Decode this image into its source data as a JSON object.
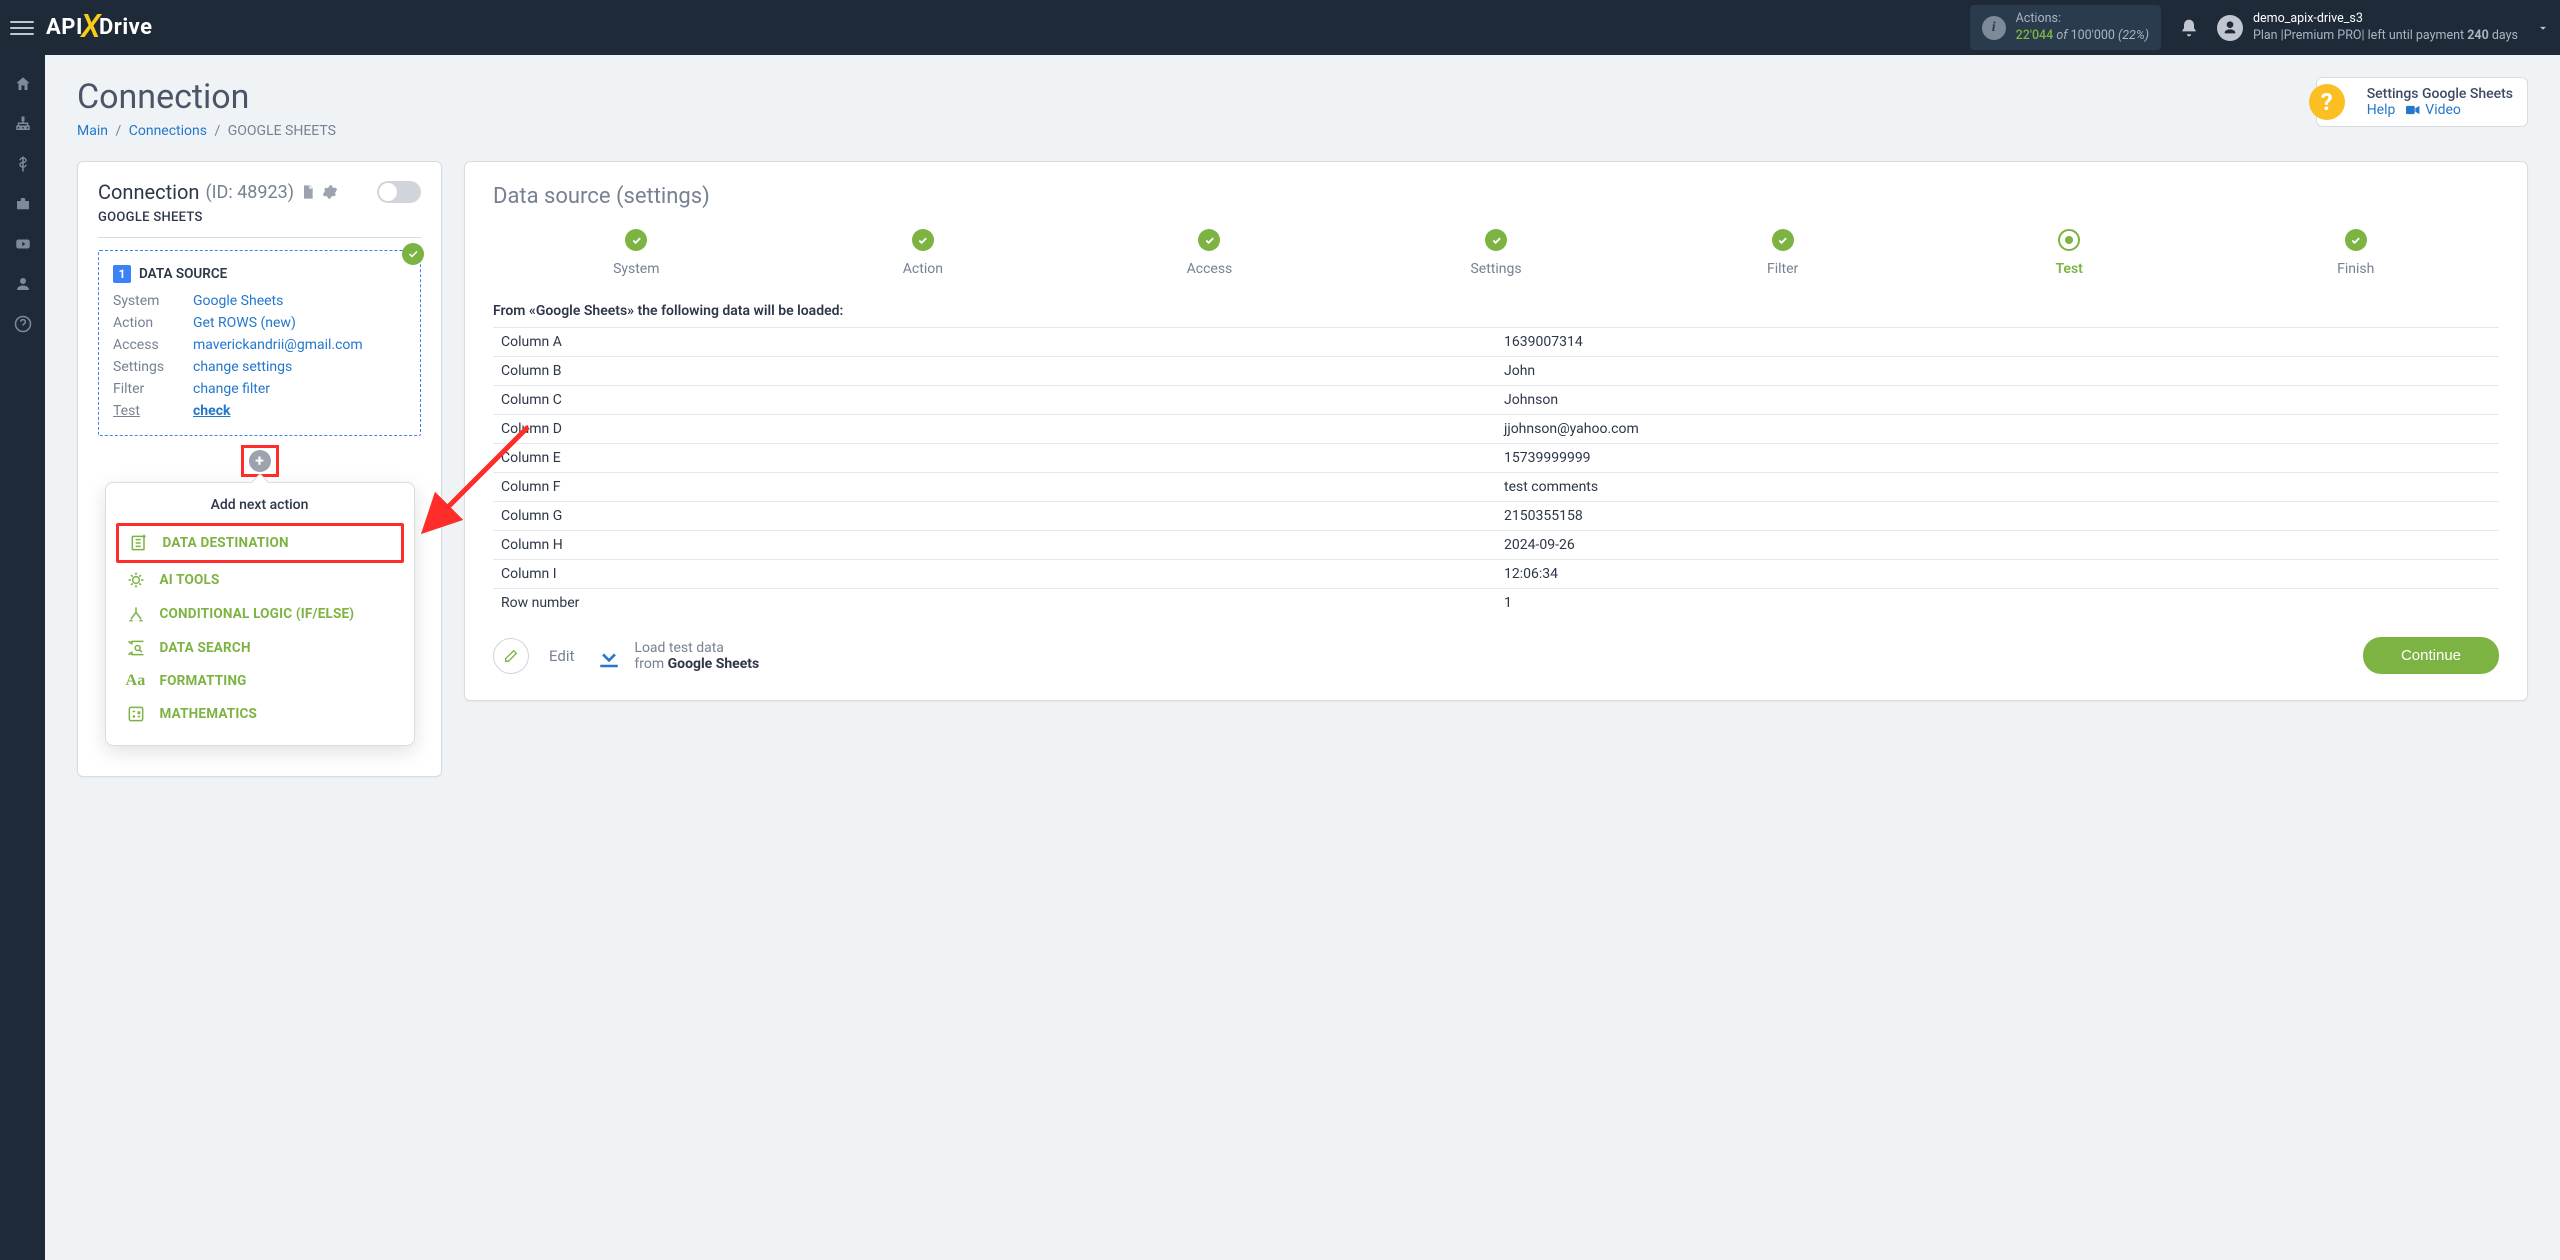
{
  "header": {
    "logo_prefix": "API",
    "logo_suffix": "Drive",
    "actions_label": "Actions:",
    "actions_count": "22'044",
    "actions_of": "of",
    "actions_total": "100'000",
    "actions_pct": "(22%)",
    "user_name": "demo_apix-drive_s3",
    "plan_prefix": "Plan |Premium PRO| left until payment ",
    "plan_days": "240",
    "plan_suffix": " days"
  },
  "page": {
    "title": "Connection",
    "breadcrumb_main": "Main",
    "breadcrumb_conn": "Connections",
    "breadcrumb_current": "GOOGLE SHEETS"
  },
  "help": {
    "title": "Settings Google Sheets",
    "help_link": "Help",
    "video_link": "Video"
  },
  "left": {
    "card_title": "Connection",
    "card_id": "(ID: 48923)",
    "conn_type": "GOOGLE SHEETS",
    "source_header": "DATA SOURCE",
    "rows": [
      {
        "label": "System",
        "value": "Google Sheets"
      },
      {
        "label": "Action",
        "value": "Get ROWS (new)"
      },
      {
        "label": "Access",
        "value": "maverickandrii@gmail.com"
      },
      {
        "label": "Settings",
        "value": "change settings"
      },
      {
        "label": "Filter",
        "value": "change filter"
      },
      {
        "label": "Test",
        "value": "check"
      }
    ]
  },
  "popover": {
    "title": "Add next action",
    "items": [
      "DATA DESTINATION",
      "AI TOOLS",
      "CONDITIONAL LOGIC (IF/ELSE)",
      "DATA SEARCH",
      "FORMATTING",
      "MATHEMATICS"
    ]
  },
  "right": {
    "title_main": "Data source ",
    "title_sub": "(settings)",
    "steps": [
      "System",
      "Action",
      "Access",
      "Settings",
      "Filter",
      "Test",
      "Finish"
    ],
    "data_head": "From «Google Sheets» the following data will be loaded:",
    "rows": [
      [
        "Column A",
        "1639007314"
      ],
      [
        "Column B",
        "John"
      ],
      [
        "Column C",
        "Johnson"
      ],
      [
        "Column D",
        "jjohnson@yahoo.com"
      ],
      [
        "Column E",
        "15739999999"
      ],
      [
        "Column F",
        "test comments"
      ],
      [
        "Column G",
        "2150355158"
      ],
      [
        "Column H",
        "2024-09-26"
      ],
      [
        "Column I",
        "12:06:34"
      ],
      [
        "Row number",
        "1"
      ]
    ],
    "edit_label": "Edit",
    "load_line1": "Load test data",
    "load_line2_prefix": "from ",
    "load_line2_bold": "Google Sheets",
    "continue": "Continue"
  }
}
